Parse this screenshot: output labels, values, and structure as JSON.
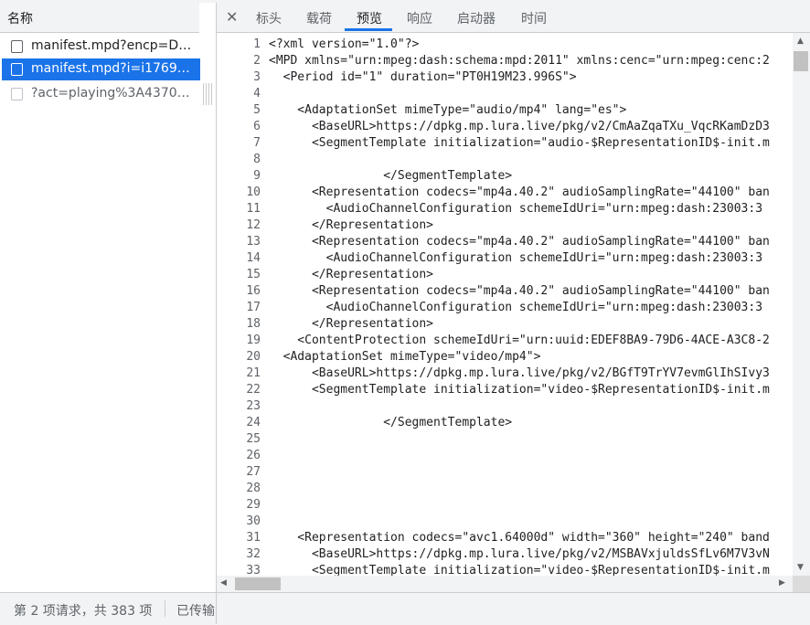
{
  "requests": {
    "header": "名称",
    "items": [
      {
        "name": "manifest.mpd?encp=DH..."
      },
      {
        "name": "manifest.mpd?i=i176947..."
      },
      {
        "name": "?act=playing%3A4370%2..."
      }
    ]
  },
  "status_bar": {
    "summary": "第 2 项请求，共 383 项",
    "transferred": "已传输"
  },
  "tabs": [
    {
      "label": "标头"
    },
    {
      "label": "载荷"
    },
    {
      "label": "预览"
    },
    {
      "label": "响应"
    },
    {
      "label": "启动器"
    },
    {
      "label": "时间"
    }
  ],
  "active_tab": "预览",
  "icons": {
    "close": "close-icon",
    "scroll_up": "chevron-up-icon",
    "scroll_down": "chevron-down-icon",
    "scroll_left": "chevron-left-icon",
    "scroll_right": "chevron-right-icon"
  },
  "colors": {
    "accent": "#1a73e8",
    "toolbar": "#f1f3f4"
  },
  "code_lines": [
    {
      "n": "1",
      "text": "<?xml version=\"1.0\"?>"
    },
    {
      "n": "2",
      "text": "<MPD xmlns=\"urn:mpeg:dash:schema:mpd:2011\" xmlns:cenc=\"urn:mpeg:cenc:2"
    },
    {
      "n": "3",
      "text": "  <Period id=\"1\" duration=\"PT0H19M23.996S\">"
    },
    {
      "n": "4",
      "text": ""
    },
    {
      "n": "5",
      "text": "    <AdaptationSet mimeType=\"audio/mp4\" lang=\"es\">"
    },
    {
      "n": "6",
      "text": "      <BaseURL>https://dpkg.mp.lura.live/pkg/v2/CmAaZqaTXu_VqcRKamDzD3"
    },
    {
      "n": "7",
      "text": "      <SegmentTemplate initialization=\"audio-$RepresentationID$-init.m"
    },
    {
      "n": "8",
      "text": ""
    },
    {
      "n": "9",
      "text": "                </SegmentTemplate>"
    },
    {
      "n": "10",
      "text": "      <Representation codecs=\"mp4a.40.2\" audioSamplingRate=\"44100\" ban"
    },
    {
      "n": "11",
      "text": "        <AudioChannelConfiguration schemeIdUri=\"urn:mpeg:dash:23003:3"
    },
    {
      "n": "12",
      "text": "      </Representation>"
    },
    {
      "n": "13",
      "text": "      <Representation codecs=\"mp4a.40.2\" audioSamplingRate=\"44100\" ban"
    },
    {
      "n": "14",
      "text": "        <AudioChannelConfiguration schemeIdUri=\"urn:mpeg:dash:23003:3"
    },
    {
      "n": "15",
      "text": "      </Representation>"
    },
    {
      "n": "16",
      "text": "      <Representation codecs=\"mp4a.40.2\" audioSamplingRate=\"44100\" ban"
    },
    {
      "n": "17",
      "text": "        <AudioChannelConfiguration schemeIdUri=\"urn:mpeg:dash:23003:3"
    },
    {
      "n": "18",
      "text": "      </Representation>"
    },
    {
      "n": "19",
      "text": "    <ContentProtection schemeIdUri=\"urn:uuid:EDEF8BA9-79D6-4ACE-A3C8-2"
    },
    {
      "n": "20",
      "text": "  <AdaptationSet mimeType=\"video/mp4\">"
    },
    {
      "n": "21",
      "text": "      <BaseURL>https://dpkg.mp.lura.live/pkg/v2/BGfT9TrYV7evmGlIhSIvy3"
    },
    {
      "n": "22",
      "text": "      <SegmentTemplate initialization=\"video-$RepresentationID$-init.m"
    },
    {
      "n": "23",
      "text": ""
    },
    {
      "n": "24",
      "text": "                </SegmentTemplate>"
    },
    {
      "n": "25",
      "text": ""
    },
    {
      "n": "26",
      "text": ""
    },
    {
      "n": "27",
      "text": ""
    },
    {
      "n": "28",
      "text": ""
    },
    {
      "n": "29",
      "text": ""
    },
    {
      "n": "30",
      "text": ""
    },
    {
      "n": "31",
      "text": "    <Representation codecs=\"avc1.64000d\" width=\"360\" height=\"240\" band"
    },
    {
      "n": "32",
      "text": "      <BaseURL>https://dpkg.mp.lura.live/pkg/v2/MSBAVxjuldsSfLv6M7V3vN"
    },
    {
      "n": "33",
      "text": "      <SegmentTemplate initialization=\"video-$RepresentationID$-init.m"
    }
  ]
}
